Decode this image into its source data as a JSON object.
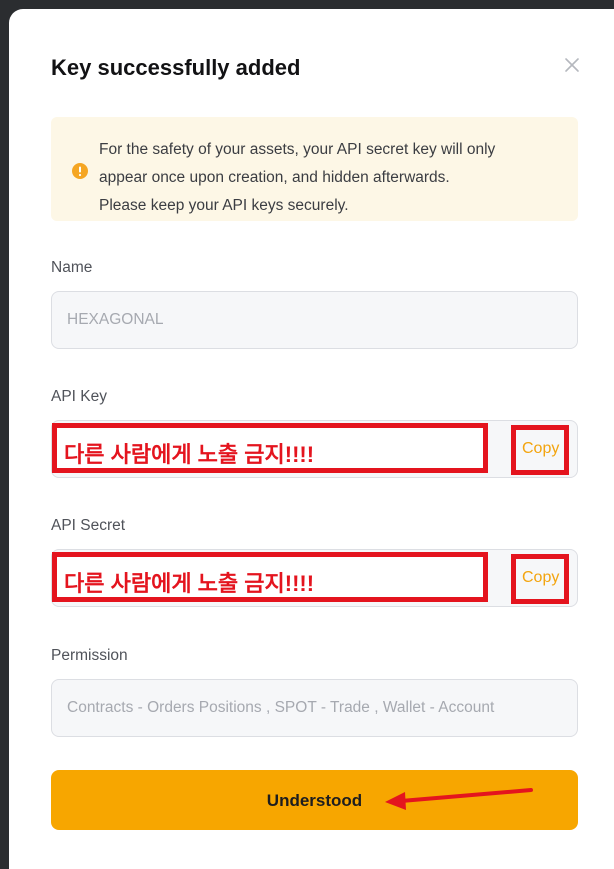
{
  "modal": {
    "title": "Key successfully added",
    "close_icon": "close-icon"
  },
  "notice": {
    "icon": "warning-circle-icon",
    "lines": [
      "For the safety of your assets, your API secret key will only",
      "appear once upon creation, and hidden afterwards.",
      "Please keep your API keys securely."
    ]
  },
  "fields": {
    "name": {
      "label": "Name",
      "value": "HEXAGONAL"
    },
    "api_key": {
      "label": "API Key",
      "redaction_text": "다른 사람에게 노출 금지!!!!",
      "copy_label": "Copy"
    },
    "api_secret": {
      "label": "API Secret",
      "redaction_text": "다른 사람에게 노출 금지!!!!",
      "copy_label": "Copy"
    },
    "permission": {
      "label": "Permission",
      "value": "Contracts - Orders Positions  , SPOT - Trade  , Wallet - Account"
    }
  },
  "actions": {
    "understood_label": "Understood"
  },
  "colors": {
    "accent": "#f7a600",
    "annotation_red": "#e4141e",
    "notice_bg": "#fdf7e6",
    "copy_text": "#f3a40e"
  }
}
